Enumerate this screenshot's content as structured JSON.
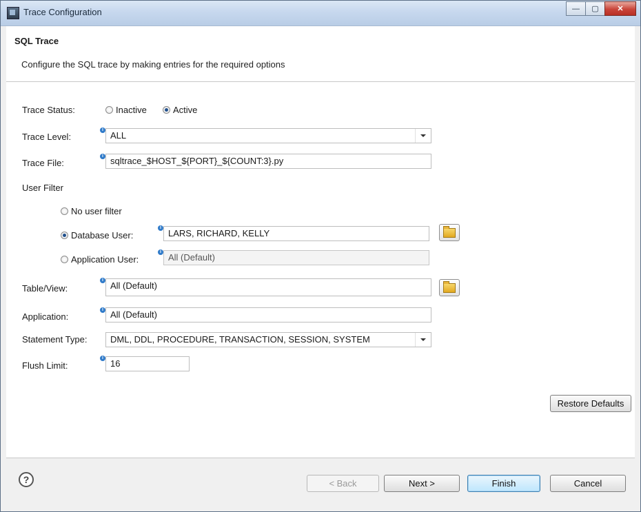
{
  "window": {
    "title": "Trace Configuration",
    "buttons": {
      "minimize": "—",
      "maximize": "▢",
      "close": "✕"
    }
  },
  "header": {
    "title": "SQL Trace",
    "description": "Configure the SQL trace by making entries for the required options"
  },
  "form": {
    "trace_status": {
      "label": "Trace Status:",
      "options": [
        "Inactive",
        "Active"
      ],
      "selected": "Active"
    },
    "trace_level": {
      "label": "Trace Level:",
      "value": "ALL"
    },
    "trace_file": {
      "label": "Trace File:",
      "value": "sqltrace_$HOST_${PORT}_${COUNT:3}.py"
    },
    "user_filter": {
      "label": "User Filter",
      "no_filter_label": "No user filter",
      "db_user_label": "Database User:",
      "db_user_value": "LARS, RICHARD, KELLY",
      "app_user_label": "Application User:",
      "app_user_value": "All (Default)",
      "selected": "Database User:"
    },
    "table_view": {
      "label": "Table/View:",
      "value": "All (Default)"
    },
    "application": {
      "label": "Application:",
      "value": "All (Default)"
    },
    "statement_type": {
      "label": "Statement Type:",
      "value": "DML, DDL, PROCEDURE, TRANSACTION, SESSION, SYSTEM"
    },
    "flush_limit": {
      "label": "Flush Limit:",
      "value": "16"
    },
    "info_glyph": "i"
  },
  "buttons": {
    "restore_defaults": "Restore Defaults",
    "back": "< Back",
    "next": "Next >",
    "finish": "Finish",
    "cancel": "Cancel",
    "help": "?"
  },
  "colors": {
    "accent": "#2f7ac9",
    "default_button": "#bee6fd",
    "close_button": "#c9453a"
  }
}
